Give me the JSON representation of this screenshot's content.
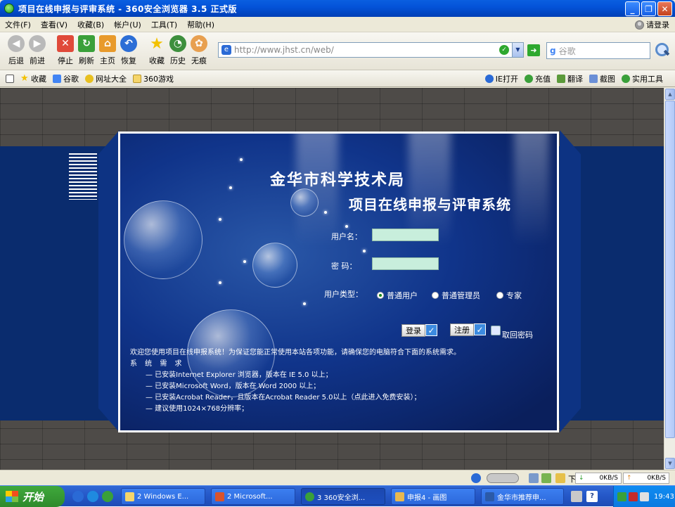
{
  "window": {
    "title": "项目在线申报与评审系统 - 360安全浏览器 3.5 正式版"
  },
  "menubar": {
    "items": [
      "文件(F)",
      "查看(V)",
      "收藏(B)",
      "帐户(U)",
      "工具(T)",
      "帮助(H)"
    ],
    "login": "请登录"
  },
  "toolbar": {
    "buttons": [
      "后退",
      "前进",
      "停止",
      "刷新",
      "主页",
      "恢复",
      "收藏",
      "历史",
      "无痕"
    ],
    "address": "http://www.jhst.cn/web/",
    "search_placeholder": "谷歌"
  },
  "favbar": {
    "left": [
      "收藏",
      "谷歌",
      "网址大全",
      "360游戏"
    ],
    "right": [
      "IE打开",
      "充值",
      "翻译",
      "截图",
      "实用工具"
    ]
  },
  "page": {
    "org_title": "金华市科学技术局",
    "system_title": "项目在线申报与评审系统",
    "username_label": "用户名：",
    "password_label": "密  码：",
    "user_type_label": "用户类型：",
    "user_types": [
      "普通用户",
      "普通管理员",
      "专家"
    ],
    "selected_user_type": "普通用户",
    "login_button": "登录",
    "register_button": "注册",
    "forgot_password": "取回密码",
    "notice": "欢迎您使用项目在线申报系统！为保证您能正常使用本站各项功能，请确保您的电脑符合下面的系统需求。",
    "requirements_title": "系 统 需 求",
    "requirements": [
      "—  已安装Internet Explorer 浏览器，版本在 IE 5.0 以上；",
      "—  已安装Microsoft Word，版本在 Word 2000 以上；",
      "—  已安装Acrobat Reader，且版本在Acrobat Reader 5.0以上（点此进入免费安装）；",
      "—  建议使用1024×768分辨率；"
    ]
  },
  "statusbar": {
    "download_speed": "0KB/S",
    "upload_speed": "0KB/S",
    "tool_label": "下"
  },
  "taskbar": {
    "start": "开始",
    "tasks": [
      "2 Windows E...",
      "2 Microsoft...",
      "3 360安全浏...",
      "申报4 - 画图",
      "金华市推荐申..."
    ],
    "clock": "19:43"
  },
  "colors": {
    "titlebar": "#0453d9",
    "panel": "#10348a",
    "input": "#c8eedc",
    "taskbar": "#2457c7"
  }
}
